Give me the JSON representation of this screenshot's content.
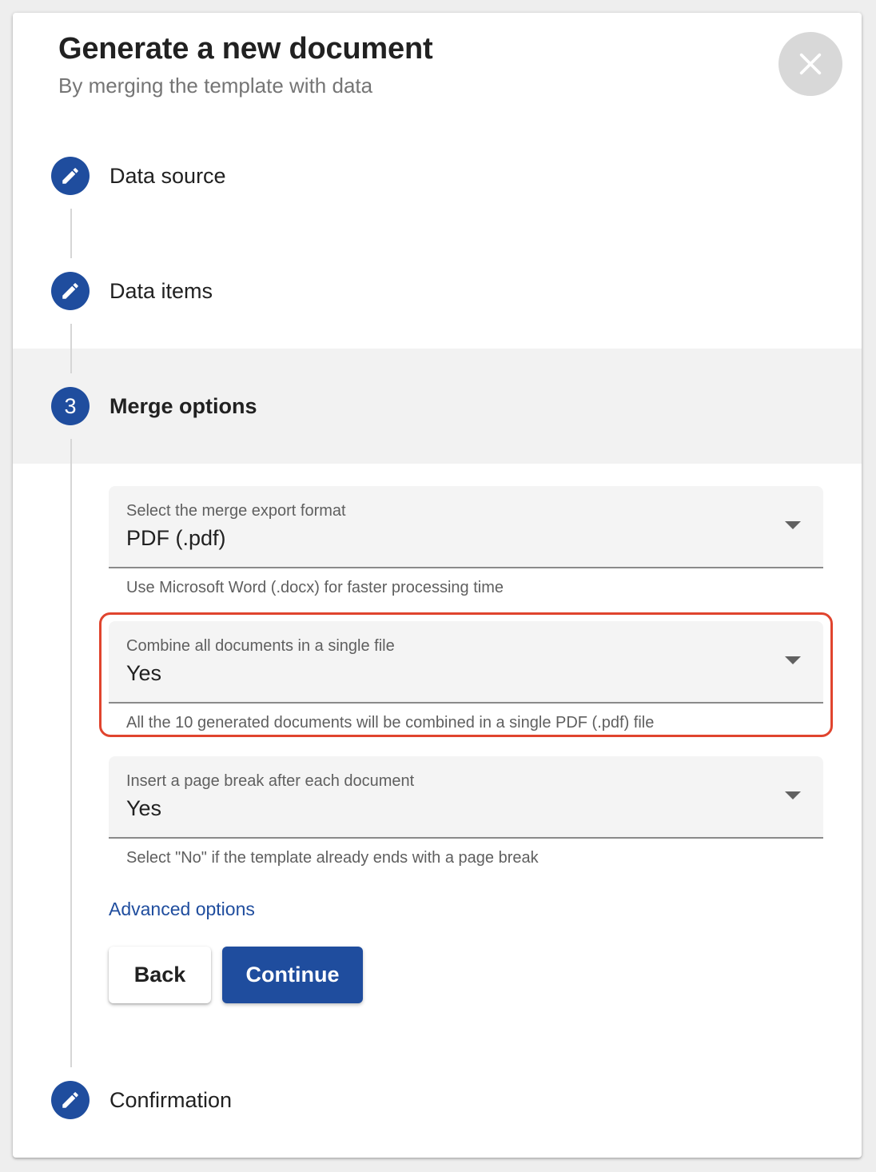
{
  "dialog": {
    "title": "Generate a new document",
    "subtitle": "By merging the template with data",
    "close_icon": "close-icon"
  },
  "steps": [
    {
      "label": "Data source",
      "status": "completed",
      "icon": "pencil-icon"
    },
    {
      "label": "Data items",
      "status": "completed",
      "icon": "pencil-icon"
    },
    {
      "label": "Merge options",
      "status": "active",
      "number": "3"
    },
    {
      "label": "Confirmation",
      "status": "completed",
      "icon": "pencil-icon"
    }
  ],
  "merge_options": {
    "export_format": {
      "label": "Select the merge export format",
      "value": "PDF (.pdf)",
      "hint": "Use Microsoft Word (.docx) for faster processing time"
    },
    "combine": {
      "label": "Combine all documents in a single file",
      "value": "Yes",
      "hint": "All the 10 generated documents will be combined in a single PDF (.pdf) file"
    },
    "page_break": {
      "label": "Insert a page break after each document",
      "value": "Yes",
      "hint": "Select \"No\" if the template already ends with a page break"
    },
    "advanced_link": "Advanced options"
  },
  "actions": {
    "back_label": "Back",
    "continue_label": "Continue"
  },
  "colors": {
    "primary": "#1f4d9e",
    "highlight": "#e0442e",
    "field_background": "#f4f4f4",
    "active_step_background": "#f2f2f2"
  }
}
